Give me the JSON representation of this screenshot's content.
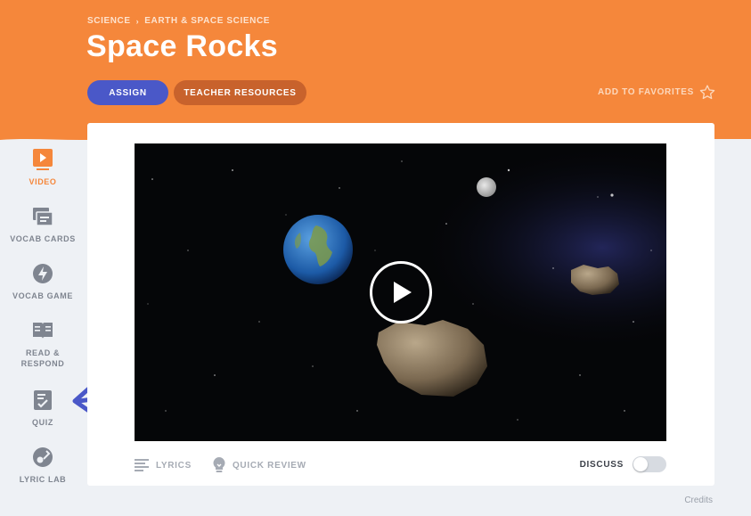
{
  "breadcrumb": [
    "SCIENCE",
    "EARTH & SPACE SCIENCE"
  ],
  "breadcrumb_separator": "›",
  "title": "Space Rocks",
  "buttons": {
    "assign": "ASSIGN",
    "teacher_resources": "TEACHER RESOURCES"
  },
  "favorites": {
    "label": "ADD TO FAVORITES",
    "icon": "star-outline-icon"
  },
  "sidebar": {
    "items": [
      {
        "label": "VIDEO",
        "icon": "video-icon",
        "active": true
      },
      {
        "label": "VOCAB CARDS",
        "icon": "vocab-cards-icon",
        "active": false
      },
      {
        "label": "VOCAB GAME",
        "icon": "lightning-icon",
        "active": false
      },
      {
        "label": "READ &\nRESPOND",
        "icon": "book-icon",
        "active": false
      },
      {
        "label": "QUIZ",
        "icon": "quiz-icon",
        "active": false
      },
      {
        "label": "LYRIC LAB",
        "icon": "guitar-icon",
        "active": false
      }
    ]
  },
  "video": {
    "play_icon": "play-icon",
    "scene": [
      "earth",
      "moon",
      "asteroids",
      "stars"
    ]
  },
  "controls": {
    "lyrics": "LYRICS",
    "quick_review": "QUICK REVIEW",
    "discuss": "DISCUSS",
    "discuss_on": false
  },
  "credits": "Credits",
  "colors": {
    "header": "#f5873b",
    "assign": "#4a58c8",
    "teacher_resources": "#c8622c",
    "active": "#f5873b",
    "arrow": "#4a58c8"
  }
}
